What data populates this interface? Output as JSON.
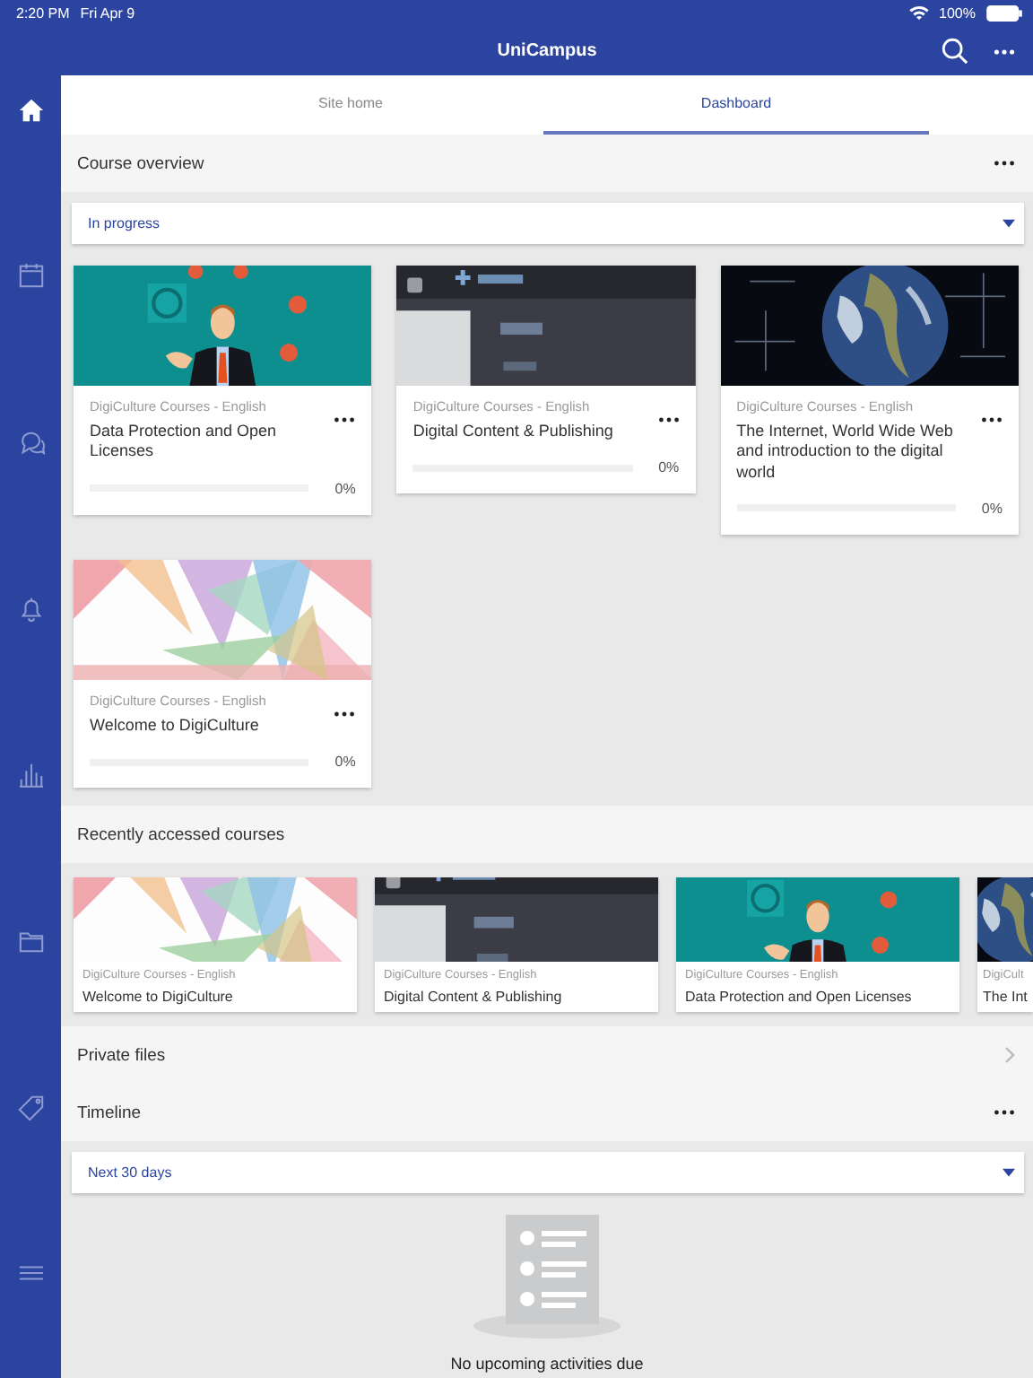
{
  "status_bar": {
    "time": "2:20 PM",
    "date": "Fri Apr 9",
    "battery": "100%"
  },
  "sidebar": {
    "items": [
      {
        "kind": "home",
        "selected": true
      },
      {
        "kind": "calendar",
        "selected": false
      },
      {
        "kind": "chat",
        "selected": false
      },
      {
        "kind": "bell",
        "selected": false
      },
      {
        "kind": "chart",
        "selected": false
      },
      {
        "kind": "folder",
        "selected": false
      },
      {
        "kind": "tag",
        "selected": false
      },
      {
        "kind": "menu",
        "selected": false
      }
    ]
  },
  "header": {
    "title": "UniCampus"
  },
  "tabs": [
    {
      "label": "Site home",
      "selected": false
    },
    {
      "label": "Dashboard",
      "selected": true
    }
  ],
  "course_overview": {
    "title": "Course overview",
    "filter": "In progress",
    "courses": [
      {
        "category": "DigiCulture Courses - English",
        "name": "Data Protection and Open Licenses",
        "level": 0,
        "progress": "0%"
      },
      {
        "category": "DigiCulture Courses - English",
        "name": "Digital Content & Publishing",
        "level": 0,
        "progress": "0%"
      },
      {
        "category": "DigiCulture Courses - English",
        "name": "The Internet, World Wide Web and introduction to the digital world",
        "level": 0,
        "progress": "0%"
      },
      {
        "category": "DigiCulture Courses - English",
        "name": "Welcome to DigiCulture",
        "level": 0,
        "progress": "0%"
      }
    ]
  },
  "recent": {
    "title": "Recently accessed courses",
    "courses": [
      {
        "category": "DigiCulture Courses - English",
        "name": "Welcome to DigiCulture"
      },
      {
        "category": "DigiCulture Courses - English",
        "name": "Digital Content & Publishing"
      },
      {
        "category": "DigiCulture Courses - English",
        "name": "Data Protection and Open Licenses"
      },
      {
        "category": "DigiCult",
        "name": "The Int"
      }
    ]
  },
  "private_files": {
    "title": "Private files"
  },
  "timeline": {
    "title": "Timeline",
    "filter": "Next 30 days",
    "empty_message": "No upcoming activities due"
  }
}
